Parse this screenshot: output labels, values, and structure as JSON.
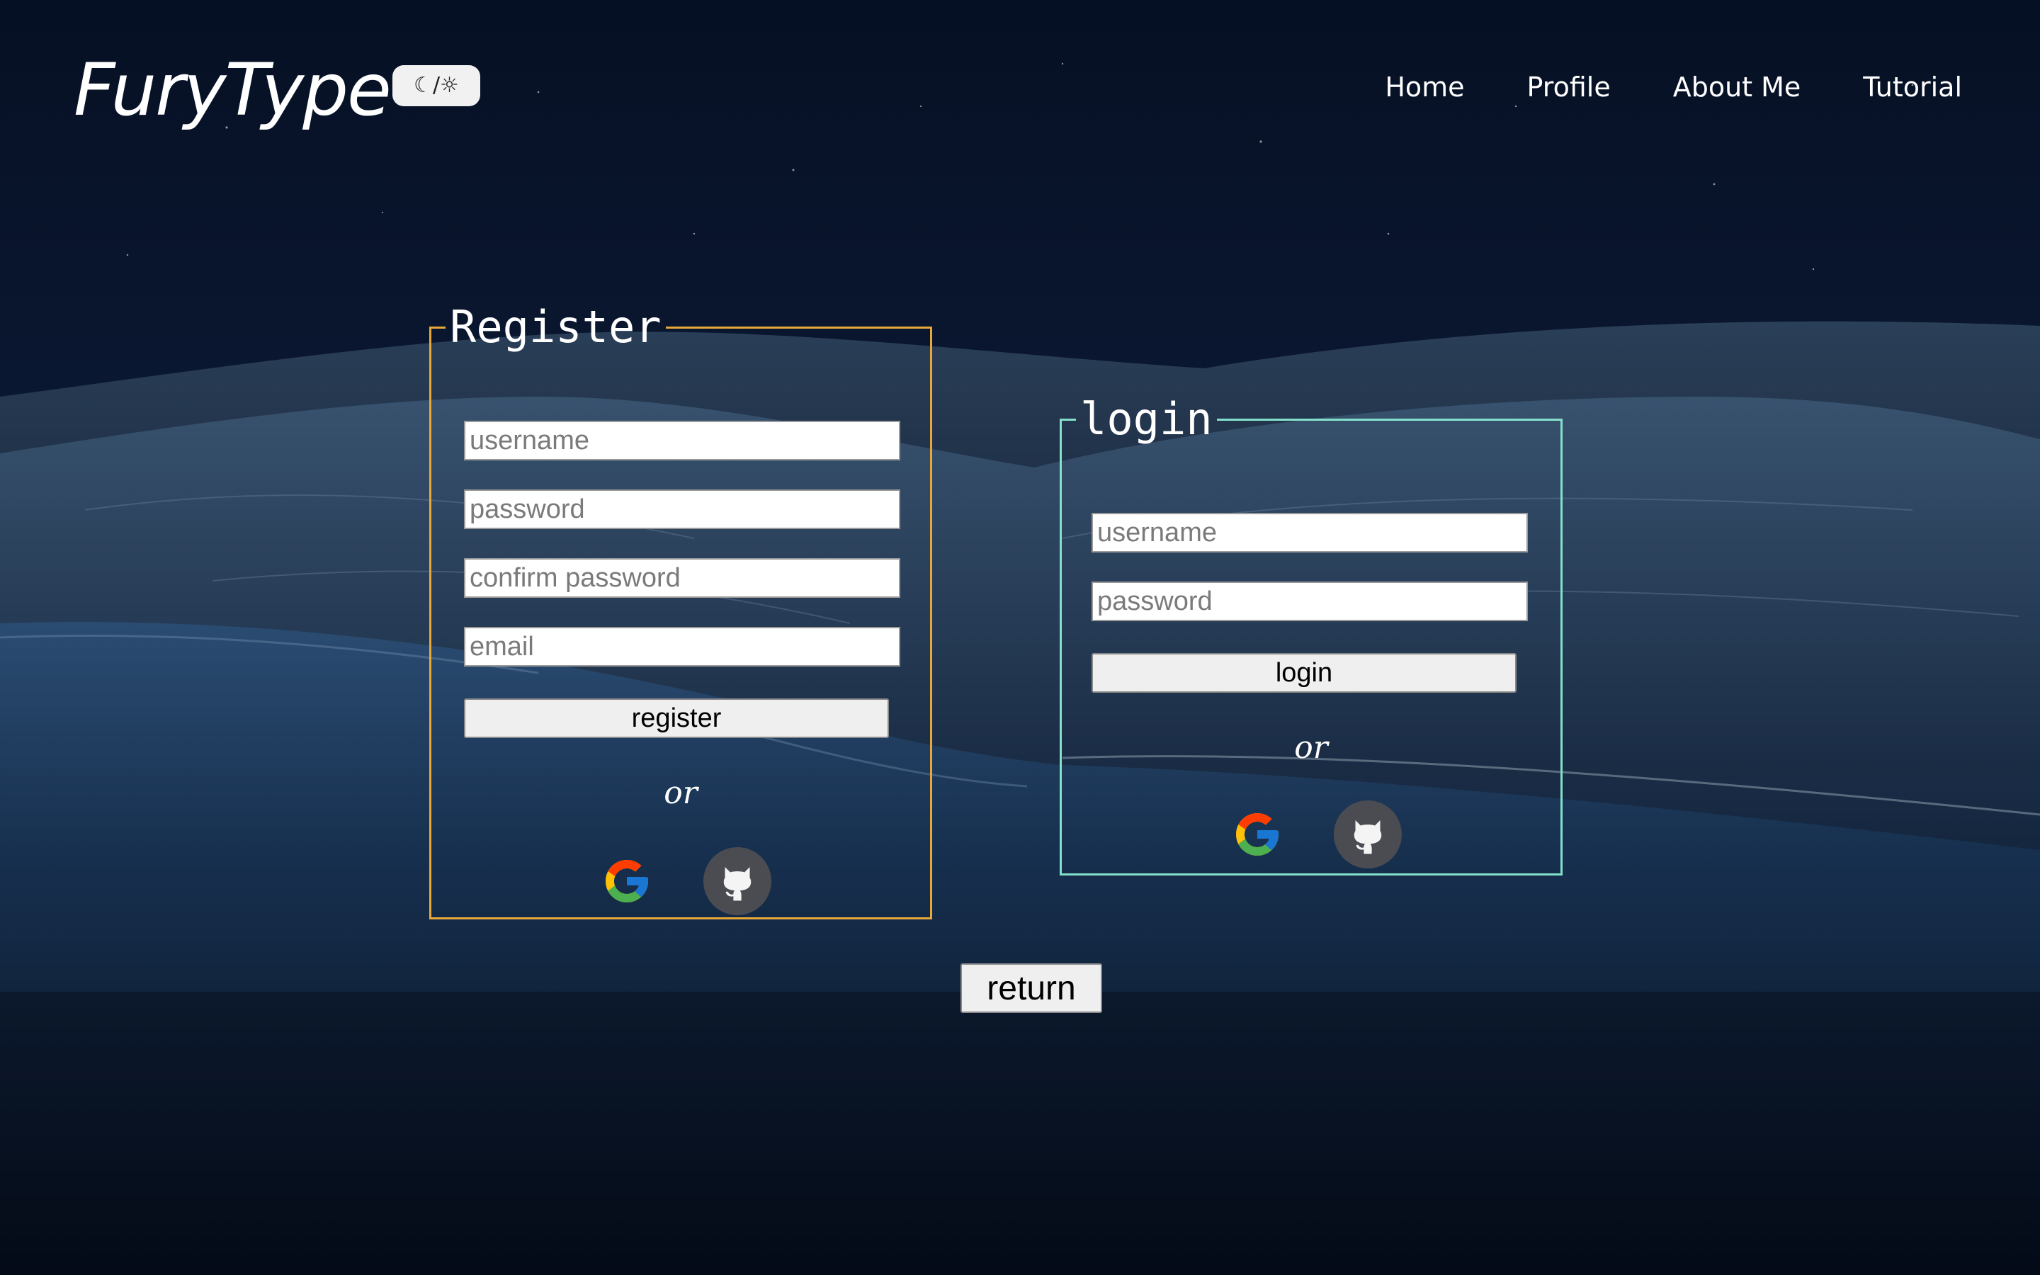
{
  "header": {
    "logo": "FuryType",
    "theme_toggle_label": "☾/☼",
    "nav": [
      {
        "label": "Home"
      },
      {
        "label": "Profile"
      },
      {
        "label": "About Me"
      },
      {
        "label": "Tutorial"
      }
    ]
  },
  "register": {
    "legend": "Register",
    "username_placeholder": "username",
    "password_placeholder": "password",
    "confirm_placeholder": "confirm password",
    "email_placeholder": "email",
    "submit_label": "register",
    "or_text": "or",
    "border_color": "#e7a83a"
  },
  "login": {
    "legend": "login",
    "username_placeholder": "username",
    "password_placeholder": "password",
    "submit_label": "login",
    "or_text": "or",
    "border_color": "#84e0cb"
  },
  "social": {
    "google_icon": "google-icon",
    "github_icon": "github-icon"
  },
  "return_label": "return"
}
